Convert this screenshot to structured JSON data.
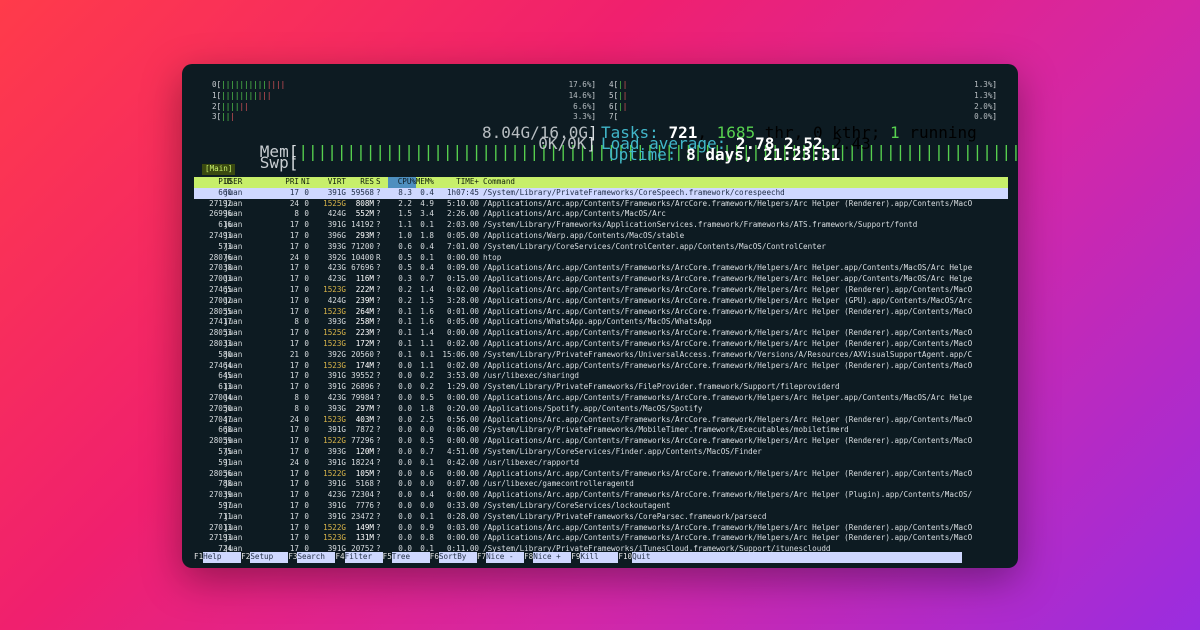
{
  "colors": {
    "background_gradient": [
      "#ff3b4a",
      "#f0206e",
      "#d427a6",
      "#9a2de0"
    ],
    "window_bg": "#0d1b22",
    "header_bg": "#c7ef6a",
    "selection_bg": "#cfd8ff"
  },
  "meters": {
    "cpu": [
      {
        "id": "0",
        "bar": "||||||||||||||",
        "value": "17.6%"
      },
      {
        "id": "1",
        "bar": "|||||||||||",
        "value": "14.6%"
      },
      {
        "id": "2",
        "bar": "||||||",
        "value": "6.6%"
      },
      {
        "id": "3",
        "bar": "|||",
        "value": "3.3%"
      },
      {
        "id": "4",
        "bar": "||",
        "value": "1.3%"
      },
      {
        "id": "5",
        "bar": "||",
        "value": "1.3%"
      },
      {
        "id": "6",
        "bar": "||",
        "value": "2.0%"
      },
      {
        "id": "7",
        "bar": "",
        "value": "0.0%"
      }
    ],
    "mem": {
      "label": "Mem",
      "bar": "||||||||||||||||||||||||||||||||||||||||||||||||||||||||||||||||||||||||||||||||||",
      "value": "8.04G/16.0G"
    },
    "swp": {
      "label": "Swp",
      "value": "0K/0K"
    }
  },
  "stats": {
    "tasks_label": "Tasks:",
    "tasks": "721",
    "thr": "1685",
    "thr_label": "thr,",
    "kthr": "0 kthr;",
    "running": "1",
    "running_label": "running",
    "load_label": "Load average:",
    "load1": "2.78",
    "load5": "2.52",
    "load15": "2.43",
    "uptime_label": "Uptime:",
    "uptime": "8 days, 21:23:31"
  },
  "tab": "Main",
  "columns": [
    "PID",
    "USER",
    "PRI",
    "NI",
    "VIRT",
    "RES",
    "S",
    "CPU%",
    "MEM%",
    "TIME+",
    "Command"
  ],
  "processes": [
    {
      "pid": "660",
      "user": "juan",
      "pri": "17",
      "ni": "0",
      "virt": "391G",
      "res": "59568",
      "s": "?",
      "cpu": "8.3",
      "mem": "0.4",
      "time": "1h07:45",
      "cmd": "/System/Library/PrivateFrameworks/CoreSpeech.framework/corespeechd"
    },
    {
      "pid": "27192",
      "user": "juan",
      "pri": "24",
      "ni": "0",
      "virt": "1525G",
      "res": "808M",
      "s": "?",
      "cpu": "2.2",
      "mem": "4.9",
      "time": "5:10.00",
      "cmd": "/Applications/Arc.app/Contents/Frameworks/ArcCore.framework/Helpers/Arc Helper (Renderer).app/Contents/MacO"
    },
    {
      "pid": "26996",
      "user": "juan",
      "pri": "8",
      "ni": "0",
      "virt": "424G",
      "res": "552M",
      "s": "?",
      "cpu": "1.5",
      "mem": "3.4",
      "time": "2:26.00",
      "cmd": "/Applications/Arc.app/Contents/MacOS/Arc"
    },
    {
      "pid": "616",
      "user": "juan",
      "pri": "17",
      "ni": "0",
      "virt": "391G",
      "res": "14192",
      "s": "?",
      "cpu": "1.1",
      "mem": "0.1",
      "time": "2:03.00",
      "cmd": "/System/Library/Frameworks/ApplicationServices.framework/Frameworks/ATS.framework/Support/fontd"
    },
    {
      "pid": "27493",
      "user": "juan",
      "pri": "17",
      "ni": "0",
      "virt": "396G",
      "res": "293M",
      "s": "?",
      "cpu": "1.0",
      "mem": "1.8",
      "time": "0:05.00",
      "cmd": "/Applications/Warp.app/Contents/MacOS/stable"
    },
    {
      "pid": "573",
      "user": "juan",
      "pri": "17",
      "ni": "0",
      "virt": "393G",
      "res": "71200",
      "s": "?",
      "cpu": "0.6",
      "mem": "0.4",
      "time": "7:01.00",
      "cmd": "/System/Library/CoreServices/ControlCenter.app/Contents/MacOS/ControlCenter"
    },
    {
      "pid": "28076",
      "user": "juan",
      "pri": "24",
      "ni": "0",
      "virt": "392G",
      "res": "10400",
      "s": "R",
      "cpu": "0.5",
      "mem": "0.1",
      "time": "0:00.00",
      "cmd": "htop"
    },
    {
      "pid": "27038",
      "user": "juan",
      "pri": "17",
      "ni": "0",
      "virt": "423G",
      "res": "67696",
      "s": "?",
      "cpu": "0.5",
      "mem": "0.4",
      "time": "0:09.00",
      "cmd": "/Applications/Arc.app/Contents/Frameworks/ArcCore.framework/Helpers/Arc Helper.app/Contents/MacOS/Arc Helpe"
    },
    {
      "pid": "27003",
      "user": "juan",
      "pri": "17",
      "ni": "0",
      "virt": "423G",
      "res": "116M",
      "s": "?",
      "cpu": "0.3",
      "mem": "0.7",
      "time": "0:15.00",
      "cmd": "/Applications/Arc.app/Contents/Frameworks/ArcCore.framework/Helpers/Arc Helper.app/Contents/MacOS/Arc Helpe"
    },
    {
      "pid": "27465",
      "user": "juan",
      "pri": "17",
      "ni": "0",
      "virt": "1523G",
      "res": "222M",
      "s": "?",
      "cpu": "0.2",
      "mem": "1.4",
      "time": "0:02.00",
      "cmd": "/Applications/Arc.app/Contents/Frameworks/ArcCore.framework/Helpers/Arc Helper (Renderer).app/Contents/MacO"
    },
    {
      "pid": "27002",
      "user": "juan",
      "pri": "17",
      "ni": "0",
      "virt": "424G",
      "res": "239M",
      "s": "?",
      "cpu": "0.2",
      "mem": "1.5",
      "time": "3:28.00",
      "cmd": "/Applications/Arc.app/Contents/Frameworks/ArcCore.framework/Helpers/Arc Helper (GPU).app/Contents/MacOS/Arc"
    },
    {
      "pid": "28055",
      "user": "juan",
      "pri": "17",
      "ni": "0",
      "virt": "1523G",
      "res": "264M",
      "s": "?",
      "cpu": "0.1",
      "mem": "1.6",
      "time": "0:01.00",
      "cmd": "/Applications/Arc.app/Contents/Frameworks/ArcCore.framework/Helpers/Arc Helper (Renderer).app/Contents/MacO"
    },
    {
      "pid": "27417",
      "user": "juan",
      "pri": "8",
      "ni": "0",
      "virt": "393G",
      "res": "258M",
      "s": "?",
      "cpu": "0.1",
      "mem": "1.6",
      "time": "0:05.00",
      "cmd": "/Applications/WhatsApp.app/Contents/MacOS/WhatsApp"
    },
    {
      "pid": "28053",
      "user": "juan",
      "pri": "17",
      "ni": "0",
      "virt": "1525G",
      "res": "223M",
      "s": "?",
      "cpu": "0.1",
      "mem": "1.4",
      "time": "0:00.00",
      "cmd": "/Applications/Arc.app/Contents/Frameworks/ArcCore.framework/Helpers/Arc Helper (Renderer).app/Contents/MacO"
    },
    {
      "pid": "28033",
      "user": "juan",
      "pri": "17",
      "ni": "0",
      "virt": "1523G",
      "res": "172M",
      "s": "?",
      "cpu": "0.1",
      "mem": "1.1",
      "time": "0:02.00",
      "cmd": "/Applications/Arc.app/Contents/Frameworks/ArcCore.framework/Helpers/Arc Helper (Renderer).app/Contents/MacO"
    },
    {
      "pid": "580",
      "user": "juan",
      "pri": "21",
      "ni": "0",
      "virt": "392G",
      "res": "20560",
      "s": "?",
      "cpu": "0.1",
      "mem": "0.1",
      "time": "15:06.00",
      "cmd": "/System/Library/PrivateFrameworks/UniversalAccess.framework/Versions/A/Resources/AXVisualSupportAgent.app/C"
    },
    {
      "pid": "27464",
      "user": "juan",
      "pri": "17",
      "ni": "0",
      "virt": "1523G",
      "res": "174M",
      "s": "?",
      "cpu": "0.0",
      "mem": "1.1",
      "time": "0:02.00",
      "cmd": "/Applications/Arc.app/Contents/Frameworks/ArcCore.framework/Helpers/Arc Helper (Renderer).app/Contents/MacO"
    },
    {
      "pid": "645",
      "user": "juan",
      "pri": "17",
      "ni": "0",
      "virt": "391G",
      "res": "39552",
      "s": "?",
      "cpu": "0.0",
      "mem": "0.2",
      "time": "3:53.00",
      "cmd": "/usr/libexec/sharingd"
    },
    {
      "pid": "613",
      "user": "juan",
      "pri": "17",
      "ni": "0",
      "virt": "391G",
      "res": "26896",
      "s": "?",
      "cpu": "0.0",
      "mem": "0.2",
      "time": "1:29.00",
      "cmd": "/System/Library/PrivateFrameworks/FileProvider.framework/Support/fileproviderd"
    },
    {
      "pid": "27004",
      "user": "juan",
      "pri": "8",
      "ni": "0",
      "virt": "423G",
      "res": "79984",
      "s": "?",
      "cpu": "0.0",
      "mem": "0.5",
      "time": "0:00.00",
      "cmd": "/Applications/Arc.app/Contents/Frameworks/ArcCore.framework/Helpers/Arc Helper.app/Contents/MacOS/Arc Helpe"
    },
    {
      "pid": "27050",
      "user": "juan",
      "pri": "8",
      "ni": "0",
      "virt": "393G",
      "res": "297M",
      "s": "?",
      "cpu": "0.0",
      "mem": "1.8",
      "time": "0:20.00",
      "cmd": "/Applications/Spotify.app/Contents/MacOS/Spotify"
    },
    {
      "pid": "27047",
      "user": "juan",
      "pri": "24",
      "ni": "0",
      "virt": "1523G",
      "res": "403M",
      "s": "?",
      "cpu": "0.0",
      "mem": "2.5",
      "time": "0:56.00",
      "cmd": "/Applications/Arc.app/Contents/Frameworks/ArcCore.framework/Helpers/Arc Helper (Renderer).app/Contents/MacO"
    },
    {
      "pid": "668",
      "user": "juan",
      "pri": "17",
      "ni": "0",
      "virt": "391G",
      "res": "7872",
      "s": "?",
      "cpu": "0.0",
      "mem": "0.0",
      "time": "0:06.00",
      "cmd": "/System/Library/PrivateFrameworks/MobileTimer.framework/Executables/mobiletimerd"
    },
    {
      "pid": "28059",
      "user": "juan",
      "pri": "17",
      "ni": "0",
      "virt": "1522G",
      "res": "77296",
      "s": "?",
      "cpu": "0.0",
      "mem": "0.5",
      "time": "0:00.00",
      "cmd": "/Applications/Arc.app/Contents/Frameworks/ArcCore.framework/Helpers/Arc Helper (Renderer).app/Contents/MacO"
    },
    {
      "pid": "575",
      "user": "juan",
      "pri": "17",
      "ni": "0",
      "virt": "393G",
      "res": "120M",
      "s": "?",
      "cpu": "0.0",
      "mem": "0.7",
      "time": "4:51.00",
      "cmd": "/System/Library/CoreServices/Finder.app/Contents/MacOS/Finder"
    },
    {
      "pid": "591",
      "user": "juan",
      "pri": "24",
      "ni": "0",
      "virt": "391G",
      "res": "18224",
      "s": "?",
      "cpu": "0.0",
      "mem": "0.1",
      "time": "0:42.00",
      "cmd": "/usr/libexec/rapportd"
    },
    {
      "pid": "28056",
      "user": "juan",
      "pri": "17",
      "ni": "0",
      "virt": "1522G",
      "res": "105M",
      "s": "?",
      "cpu": "0.0",
      "mem": "0.6",
      "time": "0:00.00",
      "cmd": "/Applications/Arc.app/Contents/Frameworks/ArcCore.framework/Helpers/Arc Helper (Renderer).app/Contents/MacO"
    },
    {
      "pid": "788",
      "user": "juan",
      "pri": "17",
      "ni": "0",
      "virt": "391G",
      "res": "5168",
      "s": "?",
      "cpu": "0.0",
      "mem": "0.0",
      "time": "0:07.00",
      "cmd": "/usr/libexec/gamecontrolleragentd"
    },
    {
      "pid": "27039",
      "user": "juan",
      "pri": "17",
      "ni": "0",
      "virt": "423G",
      "res": "72304",
      "s": "?",
      "cpu": "0.0",
      "mem": "0.4",
      "time": "0:00.00",
      "cmd": "/Applications/Arc.app/Contents/Frameworks/ArcCore.framework/Helpers/Arc Helper (Plugin).app/Contents/MacOS/"
    },
    {
      "pid": "597",
      "user": "juan",
      "pri": "17",
      "ni": "0",
      "virt": "391G",
      "res": "7776",
      "s": "?",
      "cpu": "0.0",
      "mem": "0.0",
      "time": "0:33.00",
      "cmd": "/System/Library/CoreServices/lockoutagent"
    },
    {
      "pid": "711",
      "user": "juan",
      "pri": "17",
      "ni": "0",
      "virt": "391G",
      "res": "23472",
      "s": "?",
      "cpu": "0.0",
      "mem": "0.1",
      "time": "0:28.00",
      "cmd": "/System/Library/PrivateFrameworks/CoreParsec.framework/parsecd"
    },
    {
      "pid": "27013",
      "user": "juan",
      "pri": "17",
      "ni": "0",
      "virt": "1522G",
      "res": "149M",
      "s": "?",
      "cpu": "0.0",
      "mem": "0.9",
      "time": "0:03.00",
      "cmd": "/Applications/Arc.app/Contents/Frameworks/ArcCore.framework/Helpers/Arc Helper (Renderer).app/Contents/MacO"
    },
    {
      "pid": "27193",
      "user": "juan",
      "pri": "17",
      "ni": "0",
      "virt": "1523G",
      "res": "131M",
      "s": "?",
      "cpu": "0.0",
      "mem": "0.8",
      "time": "0:00.00",
      "cmd": "/Applications/Arc.app/Contents/Frameworks/ArcCore.framework/Helpers/Arc Helper (Renderer).app/Contents/MacO"
    },
    {
      "pid": "724",
      "user": "juan",
      "pri": "17",
      "ni": "0",
      "virt": "391G",
      "res": "20752",
      "s": "?",
      "cpu": "0.0",
      "mem": "0.1",
      "time": "0:11.00",
      "cmd": "/System/Library/PrivateFrameworks/iTunesCloud.framework/Support/itunescloudd"
    }
  ],
  "fkeys": [
    {
      "key": "F1",
      "label": "Help"
    },
    {
      "key": "F2",
      "label": "Setup"
    },
    {
      "key": "F3",
      "label": "Search"
    },
    {
      "key": "F4",
      "label": "Filter"
    },
    {
      "key": "F5",
      "label": "Tree"
    },
    {
      "key": "F6",
      "label": "SortBy"
    },
    {
      "key": "F7",
      "label": "Nice -"
    },
    {
      "key": "F8",
      "label": "Nice +"
    },
    {
      "key": "F9",
      "label": "Kill"
    },
    {
      "key": "F10",
      "label": "Quit"
    }
  ]
}
